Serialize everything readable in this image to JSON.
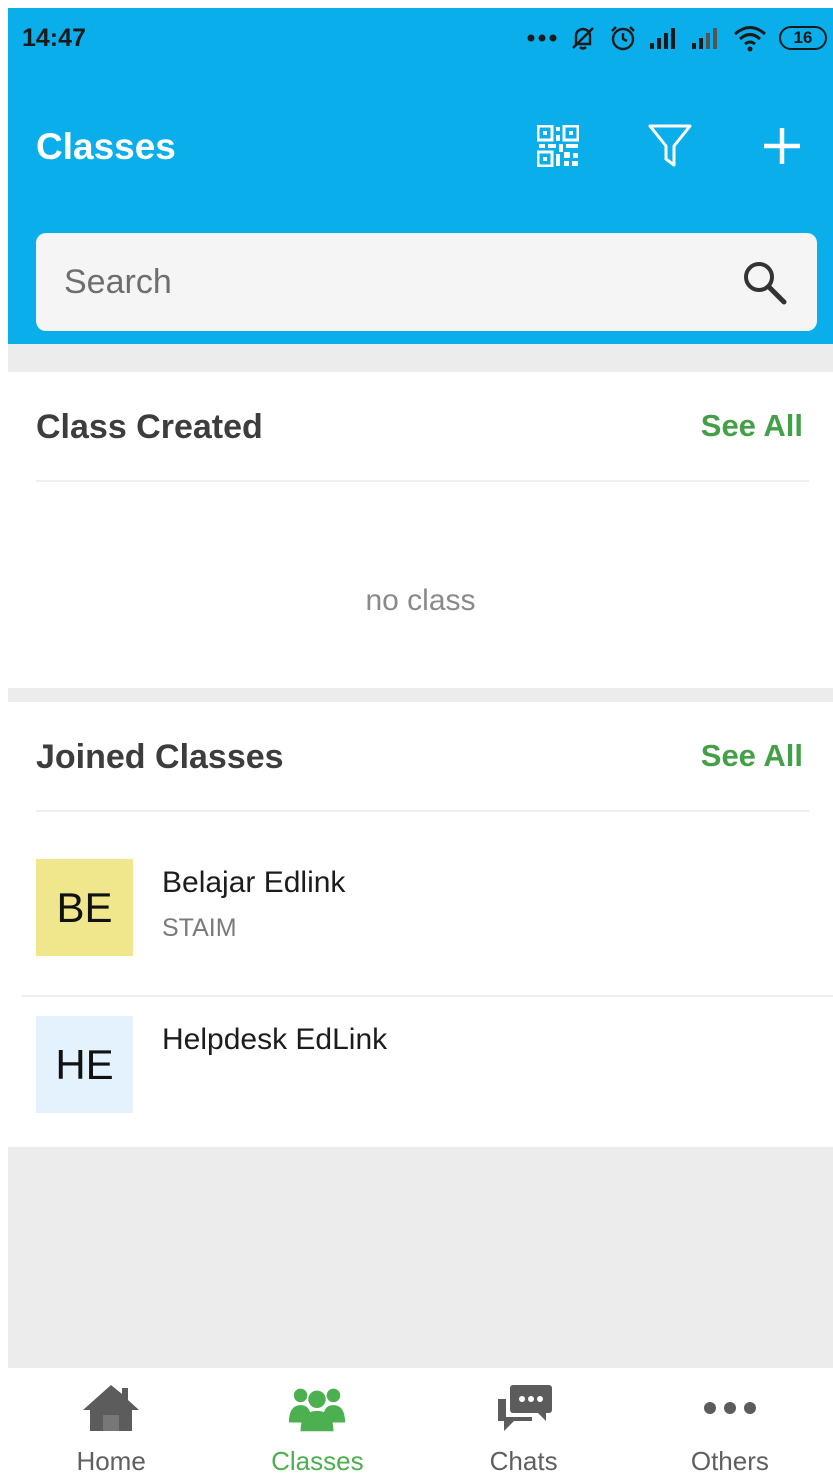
{
  "status_bar": {
    "time": "14:47",
    "battery": "16",
    "icons": [
      "more-dots-icon",
      "mute-icon",
      "alarm-icon",
      "signal-icon",
      "signal-icon",
      "wifi-icon",
      "battery-icon"
    ]
  },
  "header": {
    "title": "Classes",
    "actions": [
      "qr-code-icon",
      "filter-icon",
      "add-icon"
    ],
    "background": "#0aaeea"
  },
  "search": {
    "placeholder": "Search",
    "value": ""
  },
  "class_created": {
    "title": "Class Created",
    "see_all": "See All",
    "empty_text": "no class"
  },
  "joined_classes": {
    "title": "Joined Classes",
    "see_all": "See All",
    "items": [
      {
        "initials": "BE",
        "name": "Belajar Edlink",
        "subtitle": "STAIM",
        "avatar_color": "#f0e68c"
      },
      {
        "initials": "HE",
        "name": "Helpdesk EdLink",
        "subtitle": "",
        "avatar_color": "#e3f2fd"
      }
    ]
  },
  "bottom_nav": {
    "items": [
      {
        "label": "Home",
        "icon": "home-icon",
        "active": false
      },
      {
        "label": "Classes",
        "icon": "group-icon",
        "active": true
      },
      {
        "label": "Chats",
        "icon": "chat-icon",
        "active": false
      },
      {
        "label": "Others",
        "icon": "more-icon",
        "active": false
      }
    ],
    "active_color": "#4caf50",
    "inactive_color": "#5f5f5f"
  },
  "colors": {
    "accent_green": "#43a047"
  }
}
